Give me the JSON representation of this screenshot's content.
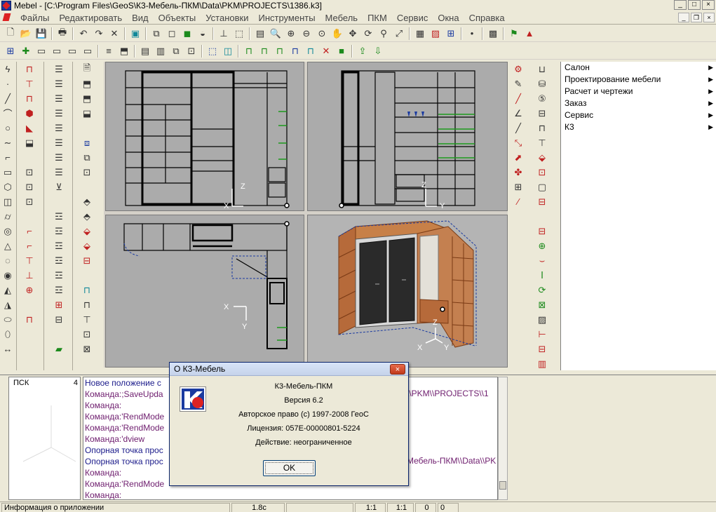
{
  "window": {
    "title": "Mebel - [C:\\Program Files\\GeoS\\К3-Мебель-ПКМ\\Data\\PKM\\PROJECTS\\1386.k3]",
    "min_label": "_",
    "max_label": "□",
    "close_label": "×"
  },
  "menu": {
    "items": [
      "Файлы",
      "Редактировать",
      "Вид",
      "Объекты",
      "Установки",
      "Инструменты",
      "Мебель",
      "ПКМ",
      "Сервис",
      "Окна",
      "Справка"
    ]
  },
  "right_panel": {
    "items": [
      {
        "label": "Салон",
        "arrow": "▶"
      },
      {
        "label": "Проектирование мебели",
        "arrow": "▶"
      },
      {
        "label": "Расчет и чертежи",
        "arrow": "▶"
      },
      {
        "label": "Заказ",
        "arrow": "▶"
      },
      {
        "label": "Сервис",
        "arrow": "▶"
      },
      {
        "label": "К3",
        "arrow": "▶"
      }
    ]
  },
  "ucs_panel": {
    "label": "ПСК",
    "number": "4"
  },
  "command_log": {
    "lines": [
      {
        "text": "Новое положение с",
        "style": "blue"
      },
      {
        "text": "Команда:;SaveUpda",
        "style": "purple"
      },
      {
        "text": "Команда:",
        "style": "purple"
      },
      {
        "text": "Команда:'RendMode",
        "style": "purple"
      },
      {
        "text": "Команда:'RendMode",
        "style": "purple"
      },
      {
        "text": "Команда:'dview",
        "style": "purple"
      },
      {
        "text": "Опорная точка прос",
        "style": "blue"
      },
      {
        "text": "Опорная точка прос",
        "style": "blue"
      },
      {
        "text": "Команда:",
        "style": "purple"
      },
      {
        "text": "Команда:'RendMode",
        "style": "purple"
      },
      {
        "text": "Команда:",
        "style": "purple"
      }
    ],
    "right_fragment_1": "\\\\PKM\\\\PROJECTS\\\\1",
    "right_fragment_2": "Мебель-ПКМ\\\\Data\\\\PK"
  },
  "status_bar": {
    "info": "Информация о приложении",
    "time": "1.8с",
    "scale1": "1:1",
    "scale2": "1:1",
    "val1": "0",
    "val2": "0"
  },
  "about_dialog": {
    "title": "О К3-Мебель",
    "close_label": "×",
    "product": "К3-Мебель-ПКМ",
    "version": "Версия 6.2",
    "copyright": "Авторское право (с) 1997-2008 ГеоС",
    "license": "Лицензия: 057Е-00000801-5224",
    "validity": "Действие: неограниченное",
    "ok_label": "OK"
  },
  "viewports": {
    "front_axes": {
      "z": "Z",
      "x": "X"
    },
    "side_axes": {
      "z": "Z",
      "y": "Y"
    },
    "top_axes": {
      "x": "X",
      "y": "Y"
    },
    "iso_axes": {
      "z": "Z",
      "x": "X",
      "y": "Y"
    }
  },
  "colors": {
    "accent": "#1a3aa0",
    "wood": "#b66a3a",
    "door": "#2a2a2a",
    "viewport_bg": "#ababab",
    "dialog_title": "#c6d3ea"
  }
}
